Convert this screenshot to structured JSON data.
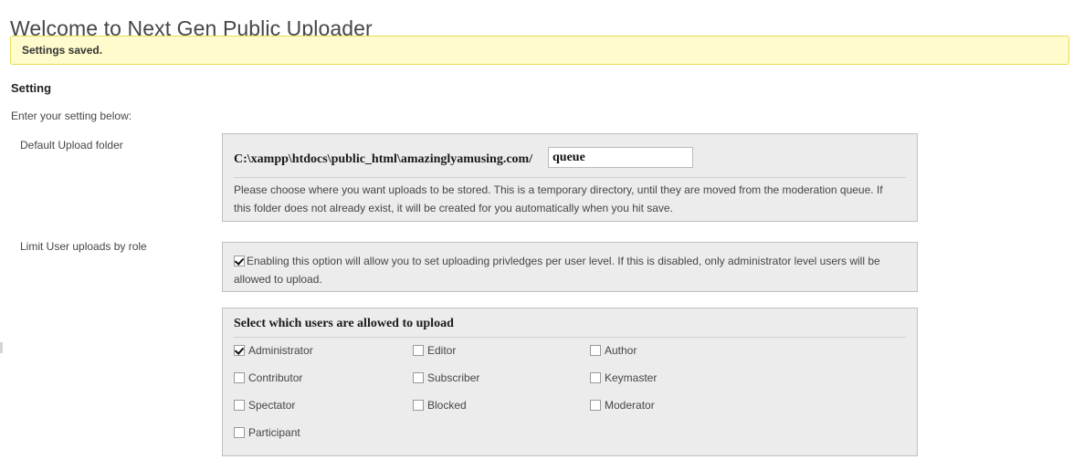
{
  "page": {
    "title": "Welcome to Next Gen Public Uploader"
  },
  "notice": {
    "text": "Settings saved.",
    "background_color": "#fffbcc",
    "border_color": "#e6db55"
  },
  "section": {
    "heading": "Setting",
    "subheading": "Enter your setting below:"
  },
  "upload_folder": {
    "label": "Default Upload folder",
    "path_prefix": "C:\\xampp\\htdocs\\public_html\\amazinglyamusing.com/",
    "input_value": "queue",
    "input_placeholder": "",
    "description": "Please choose where you want uploads to be stored. This is a temporary directory, until they are moved from the moderation queue. If this folder does not already exist, it will be created for you automatically when you hit save."
  },
  "limit_by_role": {
    "label": "Limit User uploads by role",
    "checkbox_checked": true,
    "description": "Enabling this option will allow you to set uploading privledges per user level. If this is disabled, only administrator level users will be allowed to upload."
  },
  "roles_panel": {
    "title": "Select which users are allowed to upload",
    "roles": [
      {
        "label": "Administrator",
        "checked": true
      },
      {
        "label": "Editor",
        "checked": false
      },
      {
        "label": "Author",
        "checked": false
      },
      {
        "label": "Contributor",
        "checked": false
      },
      {
        "label": "Subscriber",
        "checked": false
      },
      {
        "label": "Keymaster",
        "checked": false
      },
      {
        "label": "Spectator",
        "checked": false
      },
      {
        "label": "Blocked",
        "checked": false
      },
      {
        "label": "Moderator",
        "checked": false
      },
      {
        "label": "Participant",
        "checked": false
      }
    ]
  }
}
